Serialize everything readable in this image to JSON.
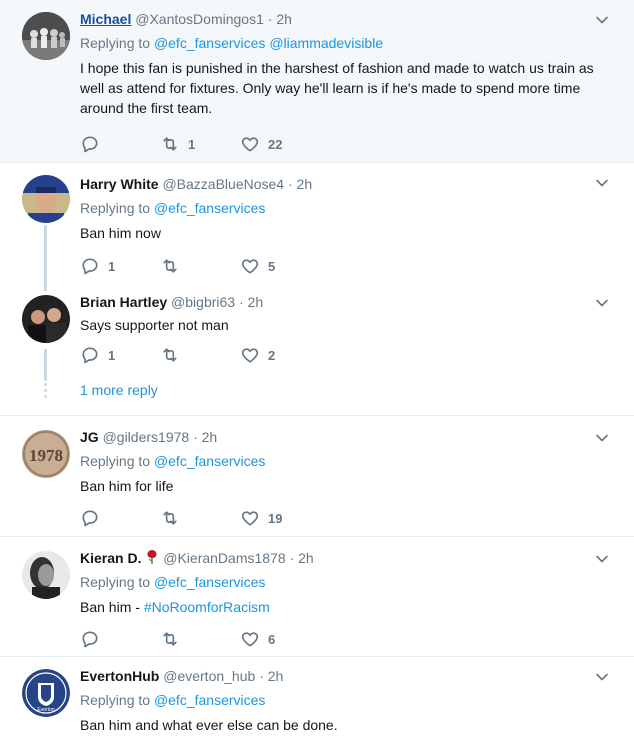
{
  "tweets": [
    {
      "name": "Michael",
      "handle": "@XantosDomingos1",
      "time": "2h",
      "replying_label": "Replying to",
      "mentions": [
        "@efc_fanservices",
        "@liammadevisible"
      ],
      "text": "I hope this fan is punished in the harshest of fashion and made to watch us train as well as attend for fixtures. Only way he'll learn is if he's made to spend more time around the first team.",
      "replies": "",
      "retweets": "1",
      "likes": "22"
    },
    {
      "name": "Harry White",
      "handle": "@BazzaBlueNose4",
      "time": "2h",
      "replying_label": "Replying to",
      "mentions": [
        "@efc_fanservices"
      ],
      "text": "Ban him now",
      "replies": "1",
      "retweets": "",
      "likes": "5"
    },
    {
      "name": "Brian Hartley",
      "handle": "@bigbri63",
      "time": "2h",
      "text": "Says supporter not man",
      "replies": "1",
      "retweets": "",
      "likes": "2",
      "more_replies": "1 more reply"
    },
    {
      "name": "JG",
      "handle": "@gilders1978",
      "time": "2h",
      "replying_label": "Replying to",
      "mentions": [
        "@efc_fanservices"
      ],
      "text": "Ban him for life",
      "replies": "",
      "retweets": "",
      "likes": "19",
      "avatar_text": "1978"
    },
    {
      "name": "Kieran D.",
      "name_emoji": "rose-icon",
      "handle": "@KieranDams1878",
      "time": "2h",
      "replying_label": "Replying to",
      "mentions": [
        "@efc_fanservices"
      ],
      "text": "Ban him - ",
      "hashtag": "#NoRoomforRacism",
      "replies": "",
      "retweets": "",
      "likes": "6"
    },
    {
      "name": "EvertonHub",
      "handle": "@everton_hub",
      "time": "2h",
      "replying_label": "Replying to",
      "mentions": [
        "@efc_fanservices"
      ],
      "text": "Ban him and what ever else can be done.",
      "avatar_text": "Everton"
    }
  ],
  "colors": {
    "link": "#1b95e0",
    "muted": "#657786",
    "highlight_bg": "#f5f8fa",
    "everton_blue": "#274488"
  }
}
